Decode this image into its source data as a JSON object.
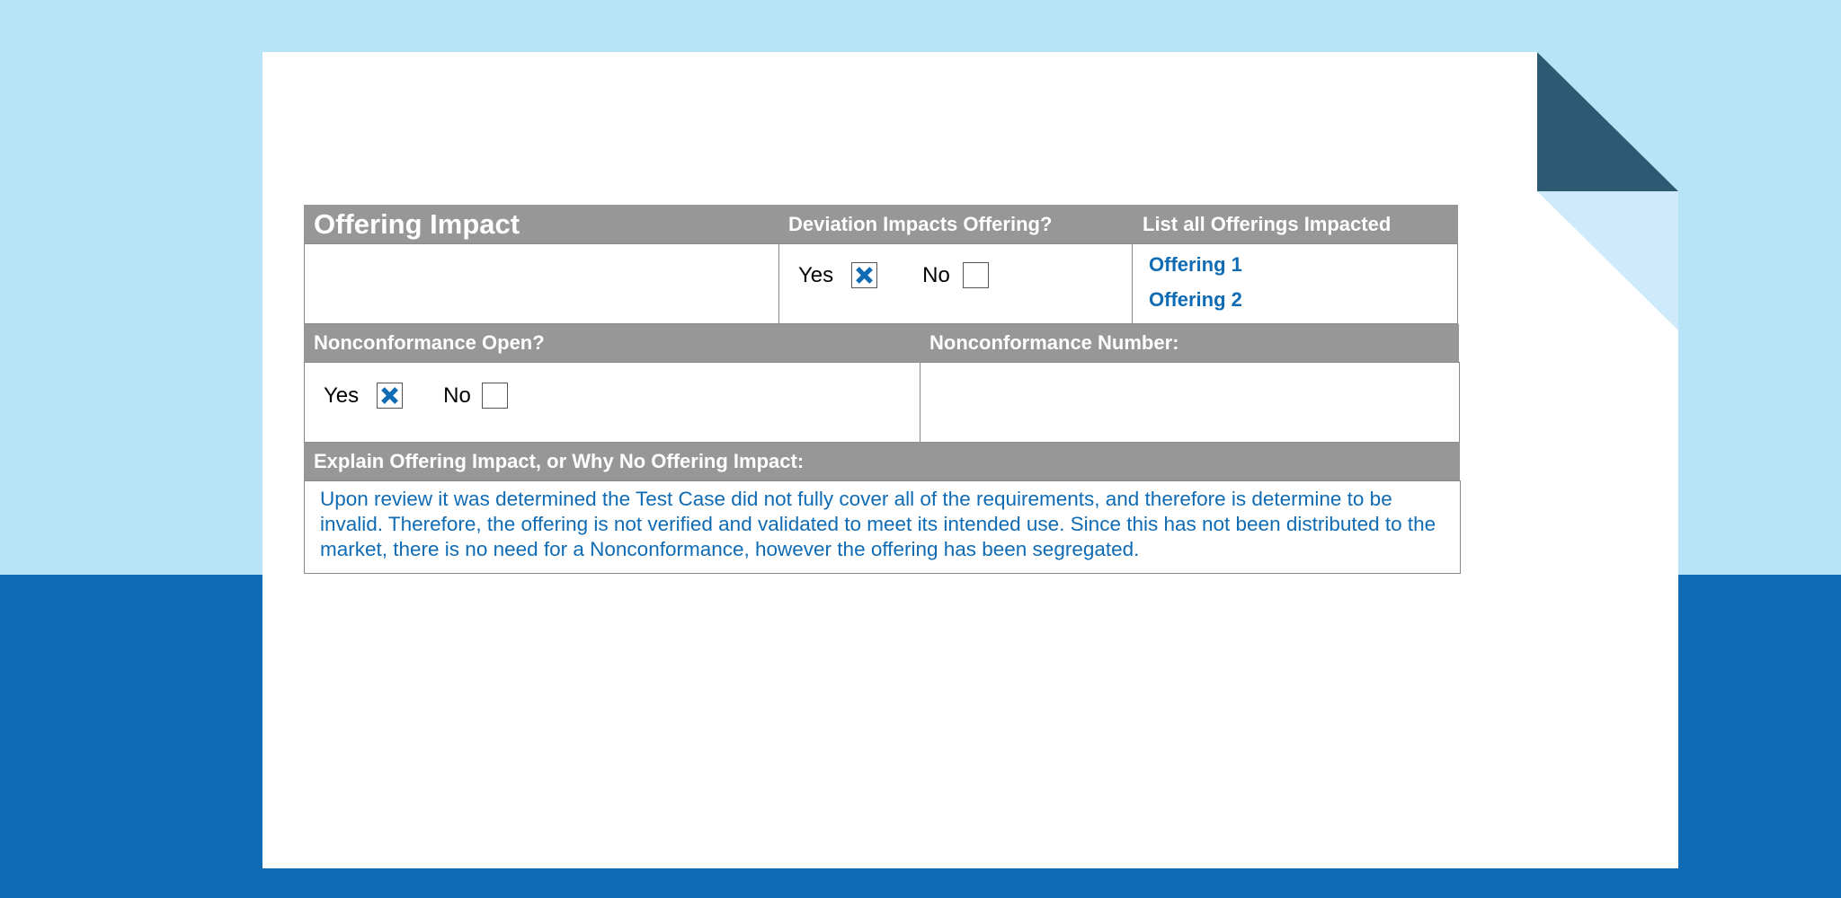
{
  "form": {
    "title": "Offering Impact",
    "deviation_header": "Deviation Impacts Offering?",
    "offerings_header": "List all Offerings Impacted",
    "deviation": {
      "yes_label": "Yes",
      "no_label": "No",
      "yes_checked": true,
      "no_checked": false
    },
    "offerings": [
      "Offering 1",
      "Offering 2"
    ],
    "nc_open_header": "Nonconformance Open?",
    "nc_number_header": "Nonconformance Number:",
    "nc_open": {
      "yes_label": "Yes",
      "no_label": "No",
      "yes_checked": true,
      "no_checked": false
    },
    "nc_number_value": "",
    "explain_header": "Explain Offering Impact, or Why No Offering Impact:",
    "explain_text": "Upon review it was determined the Test Case did not fully cover all of the requirements, and therefore is determine to be invalid.  Therefore, the offering is not verified and validated to meet its intended use.  Since this has not been distributed to the market, there is no need for a Nonconformance, however the offering has been segregated."
  },
  "colors": {
    "accent": "#0f6bb4",
    "header_gray": "#979797",
    "background_light": "#b8e4f8",
    "background_dark": "#0f6bb4",
    "fold_dark": "#2c5a73"
  },
  "icons": {
    "checked_box": "x-mark-icon"
  }
}
